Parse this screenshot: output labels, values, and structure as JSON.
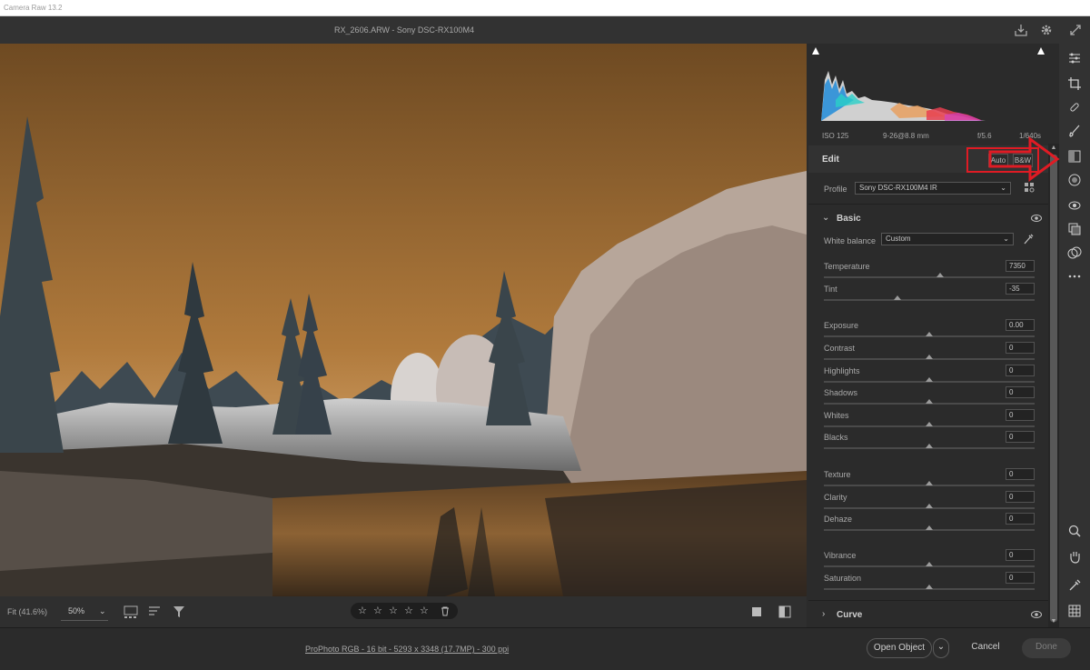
{
  "window": {
    "title": "Camera Raw 13.2"
  },
  "header": {
    "file_info": "RX_2606.ARW  -  Sony DSC-RX100M4"
  },
  "exif": {
    "iso": "ISO 125",
    "lens": "9-26@8.8 mm",
    "aperture": "f/5.6",
    "shutter": "1/640s"
  },
  "edit": {
    "title": "Edit",
    "auto_label": "Auto",
    "bw_label": "B&W",
    "profile_label": "Profile",
    "profile_value": "Sony DSC-RX100M4 IR"
  },
  "basic": {
    "title": "Basic",
    "white_balance_label": "White balance",
    "white_balance_value": "Custom",
    "sliders": [
      {
        "label": "Temperature",
        "value": "7350",
        "position": 0.55
      },
      {
        "label": "Tint",
        "value": "-35",
        "position": 0.35
      },
      {
        "label": "Exposure",
        "value": "0.00",
        "position": 0.5
      },
      {
        "label": "Contrast",
        "value": "0",
        "position": 0.5
      },
      {
        "label": "Highlights",
        "value": "0",
        "position": 0.5
      },
      {
        "label": "Shadows",
        "value": "0",
        "position": 0.5
      },
      {
        "label": "Whites",
        "value": "0",
        "position": 0.5
      },
      {
        "label": "Blacks",
        "value": "0",
        "position": 0.5
      },
      {
        "label": "Texture",
        "value": "0",
        "position": 0.5
      },
      {
        "label": "Clarity",
        "value": "0",
        "position": 0.5
      },
      {
        "label": "Dehaze",
        "value": "0",
        "position": 0.5
      },
      {
        "label": "Vibrance",
        "value": "0",
        "position": 0.5
      },
      {
        "label": "Saturation",
        "value": "0",
        "position": 0.5
      }
    ]
  },
  "curve": {
    "title": "Curve"
  },
  "image_bar": {
    "fit_label": "Fit (41.6%)",
    "zoom_value": "50%"
  },
  "footer": {
    "workflow_link": "ProPhoto RGB - 16 bit - 5293 x 3348 (17.7MP) - 300 ppi",
    "open_label": "Open Object",
    "cancel_label": "Cancel",
    "done_label": "Done"
  },
  "colors": {
    "accent_annotation": "#e01b24",
    "sky": "#b07a3c"
  }
}
